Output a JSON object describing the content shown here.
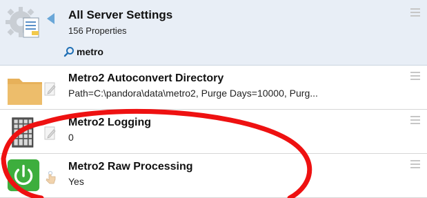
{
  "header": {
    "title": "All Server Settings",
    "subtitle": "156 Properties",
    "search": {
      "value": "metro",
      "placeholder": ""
    },
    "icons": {
      "main": "gear-document-icon",
      "back": "back-arrow-icon",
      "search": "search-icon",
      "handle": "drag-handle-icon"
    }
  },
  "items": [
    {
      "title": "Metro2 Autoconvert Directory",
      "value": "Path=C:\\pandora\\data\\metro2, Purge Days=10000, Purg...",
      "icon": "folder-icon",
      "action_icon": "edit-pencil-icon"
    },
    {
      "title": "Metro2 Logging",
      "value": "0",
      "icon": "grid-icon",
      "action_icon": "edit-pencil-icon"
    },
    {
      "title": "Metro2 Raw Processing",
      "value": "Yes",
      "icon": "power-icon",
      "action_icon": "tap-hand-icon"
    }
  ],
  "colors": {
    "header_bg": "#e8eef6",
    "folder": "#e7b15a",
    "power_bg": "#3dae3d",
    "annotation_ellipse": "#ee1111",
    "back_arrow": "#6aa7d8"
  }
}
